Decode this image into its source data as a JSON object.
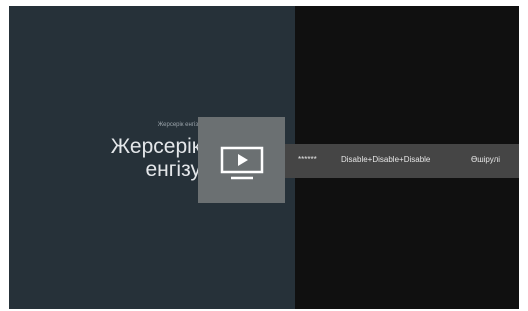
{
  "left_panel": {
    "breadcrumb": "Жерсерік енгізу",
    "title_line1": "Жерсерік",
    "title_line2": "енгізу"
  },
  "card": {
    "icon": "tv-play-icon"
  },
  "settings_row": {
    "items": [
      {
        "label": "******"
      },
      {
        "label": "Disable+Disable+Disable"
      },
      {
        "label": "Өшірулі"
      }
    ]
  },
  "colors": {
    "left_panel_bg": "#263139",
    "right_bg": "#101010",
    "card_bg": "#6b7072",
    "row_bg": "#454545"
  }
}
